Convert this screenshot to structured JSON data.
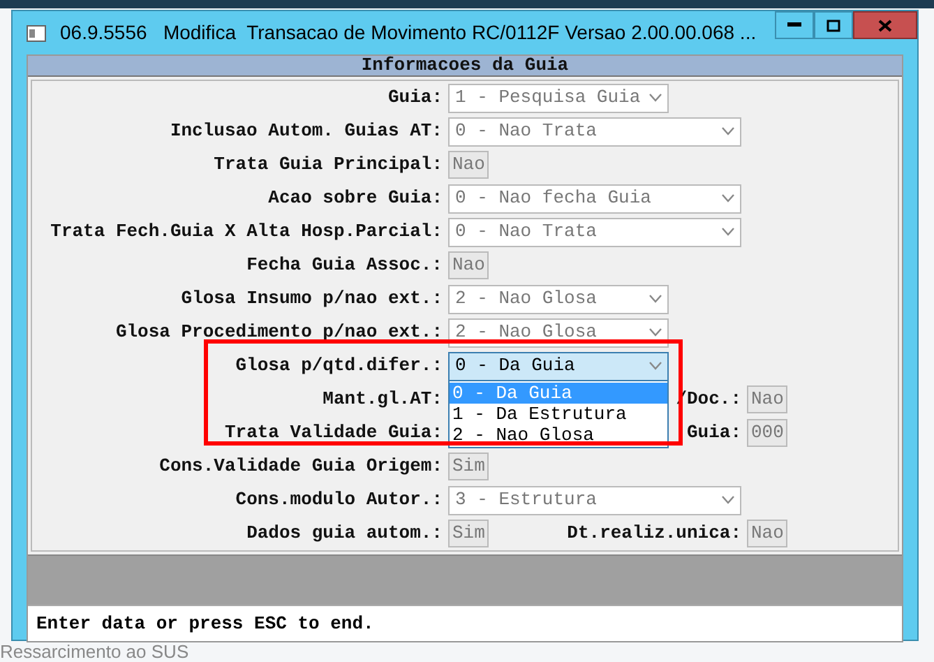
{
  "background": {
    "fragments": [
      "Ressarcimento ao SUS"
    ]
  },
  "window": {
    "title": "06.9.5556   Modifica  Transacao de Movimento RC/0112F Versao 2.00.00.068 ...",
    "controls": [
      {
        "kind": "minimize"
      },
      {
        "kind": "maximize"
      },
      {
        "kind": "close"
      }
    ]
  },
  "panel": {
    "title": "Informacoes da Guia",
    "rows": [
      {
        "label": "Guia:",
        "field": {
          "kind": "select",
          "value": "1 - Pesquisa Guia",
          "disabled": true,
          "expanded": false
        }
      },
      {
        "label": "Inclusao Autom. Guias AT:",
        "field": {
          "kind": "select",
          "value": "0 - Nao Trata",
          "disabled": true,
          "expanded": false
        }
      },
      {
        "label": "Trata Guia Principal:",
        "field": {
          "kind": "box",
          "value": "Nao",
          "disabled": true
        }
      },
      {
        "label": "Acao sobre Guia:",
        "field": {
          "kind": "select",
          "value": "0 - Nao fecha Guia",
          "disabled": true,
          "expanded": false
        }
      },
      {
        "label": "Trata Fech.Guia X Alta Hosp.Parcial:",
        "field": {
          "kind": "select",
          "value": "0 - Nao Trata",
          "disabled": true,
          "expanded": false
        }
      },
      {
        "label": "Fecha Guia Assoc.:",
        "field": {
          "kind": "box",
          "value": "Nao",
          "disabled": true
        }
      },
      {
        "label": "Glosa Insumo p/nao ext.:",
        "field": {
          "kind": "select",
          "value": "2 - Nao Glosa",
          "disabled": true,
          "expanded": false
        }
      },
      {
        "label": "Glosa Procedimento p/nao ext.:",
        "field": {
          "kind": "select",
          "value": "2 - Nao Glosa",
          "disabled": true,
          "expanded": false
        }
      },
      {
        "label": "Glosa p/qtd.difer.:",
        "field": {
          "kind": "select",
          "value": "0 - Da Guia",
          "disabled": false,
          "expanded": true,
          "options": [
            {
              "label": "0 - Da Guia",
              "selected": true
            },
            {
              "label": "1 - Da Estrutura",
              "selected": false
            },
            {
              "label": "2 - Nao Glosa",
              "selected": false
            }
          ]
        }
      },
      {
        "label": "Mant.gl.AT:",
        "extra": {
          "label": "/Doc.:",
          "field": {
            "kind": "box",
            "value": "Nao",
            "disabled": true
          }
        }
      },
      {
        "label": "Trata Validade Guia:",
        "extra": {
          "label": "Guia:",
          "field": {
            "kind": "box",
            "value": "000",
            "disabled": true
          }
        }
      },
      {
        "label": "Cons.Validade Guia Origem:",
        "field": {
          "kind": "box",
          "value": "Sim",
          "disabled": true
        }
      },
      {
        "label": "Cons.modulo Autor.:",
        "field": {
          "kind": "select",
          "value": "3 - Estrutura",
          "disabled": true,
          "expanded": false
        }
      },
      {
        "label": "Dados guia autom.:",
        "field": {
          "kind": "box",
          "value": "Sim",
          "disabled": true
        },
        "extra": {
          "label": "Dt.realiz.unica:",
          "field": {
            "kind": "box",
            "value": "Nao",
            "disabled": true
          }
        }
      }
    ]
  },
  "status_bar": {
    "text": "Enter data or press ESC to end."
  }
}
